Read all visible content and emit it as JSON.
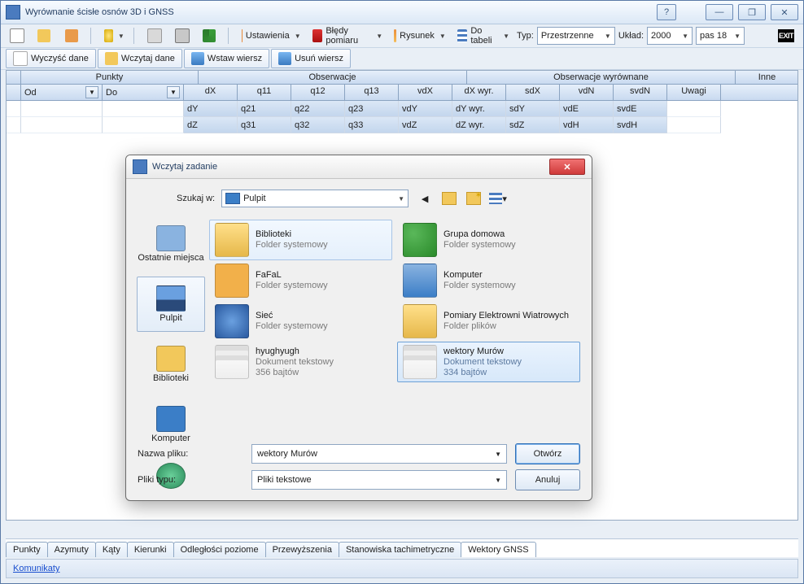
{
  "window": {
    "title": "Wyrównanie ścisłe osnów 3D i GNSS",
    "title_controls": {
      "help": "?",
      "min": "—",
      "restore": "❐",
      "close": "✕"
    }
  },
  "toolbar": {
    "settings": "Ustawienia",
    "errors": "Błędy pomiaru",
    "drawing": "Rysunek",
    "to_table": "Do tabeli",
    "type_label": "Typ:",
    "type_value": "Przestrzenne",
    "system_label": "Układ:",
    "system_value": "2000",
    "strip_value": "pas 18",
    "exit": "EXIT"
  },
  "cmds": {
    "clear": "Wyczyść dane",
    "load": "Wczytaj dane",
    "insert": "Wstaw wiersz",
    "delete": "Usuń wiersz"
  },
  "grid": {
    "groups": {
      "pts": "Punkty",
      "obs": "Obserwacje",
      "obs_adj": "Obserwacje wyrównane",
      "other": "Inne"
    },
    "cols": {
      "od": "Od",
      "do": "Do",
      "dX": "dX",
      "q11": "q11",
      "q12": "q12",
      "q13": "q13",
      "vdX": "vdX",
      "dXw": "dX wyr.",
      "sdX": "sdX",
      "vdN": "vdN",
      "svdN": "svdN",
      "uwagi": "Uwagi",
      "dY": "dY",
      "q21": "q21",
      "q22": "q22",
      "q23": "q23",
      "vdY": "vdY",
      "dYw": "dY wyr.",
      "sdY": "sdY",
      "vdE": "vdE",
      "svdE": "svdE",
      "dZ": "dZ",
      "q31": "q31",
      "q32": "q32",
      "q33": "q33",
      "vdZ": "vdZ",
      "dZw": "dZ wyr.",
      "sdZ": "sdZ",
      "vdH": "vdH",
      "svdH": "svdH"
    }
  },
  "tabs": [
    "Punkty",
    "Azymuty",
    "Kąty",
    "Kierunki",
    "Odległości poziome",
    "Przewyższenia",
    "Stanowiska tachimetryczne",
    "Wektory GNSS"
  ],
  "active_tab": 7,
  "status": {
    "messages": "Komunikaty"
  },
  "dialog": {
    "title": "Wczytaj zadanie",
    "lookin_label": "Szukaj w:",
    "lookin_value": "Pulpit",
    "places": [
      "Ostatnie miejsca",
      "Pulpit",
      "Biblioteki",
      "Komputer",
      ""
    ],
    "active_place": 1,
    "files": [
      {
        "name": "Biblioteki",
        "desc": "Folder systemowy",
        "sel": "input",
        "icon": "lib"
      },
      {
        "name": "Grupa domowa",
        "desc": "Folder systemowy",
        "icon": "group"
      },
      {
        "name": "FaFaL",
        "desc": "Folder systemowy",
        "icon": "user"
      },
      {
        "name": "Komputer",
        "desc": "Folder systemowy",
        "icon": "pc"
      },
      {
        "name": "Sieć",
        "desc": "Folder systemowy",
        "icon": "net"
      },
      {
        "name": "Pomiary Elektrowni Wiatrowych",
        "desc": "Folder plików",
        "icon": "folder"
      },
      {
        "name": "hyughyugh",
        "desc": "Dokument tekstowy",
        "size": "356 bajtów",
        "icon": "txt"
      },
      {
        "name": "wektory Murów",
        "desc": "Dokument tekstowy",
        "size": "334 bajtów",
        "sel": "sel",
        "icon": "txt"
      }
    ],
    "filename_label": "Nazwa pliku:",
    "filename_value": "wektory Murów",
    "filetype_label": "Pliki typu:",
    "filetype_value": "Pliki tekstowe",
    "open": "Otwórz",
    "cancel": "Anuluj"
  },
  "icons": {
    "folder": "#f2c85b",
    "user": "#f2b04a",
    "net": "#3b7ec7",
    "txt": "#e6e6e6",
    "pc": "#3b7ec7",
    "group": "#2a6",
    "lib": "#f2c85b"
  }
}
